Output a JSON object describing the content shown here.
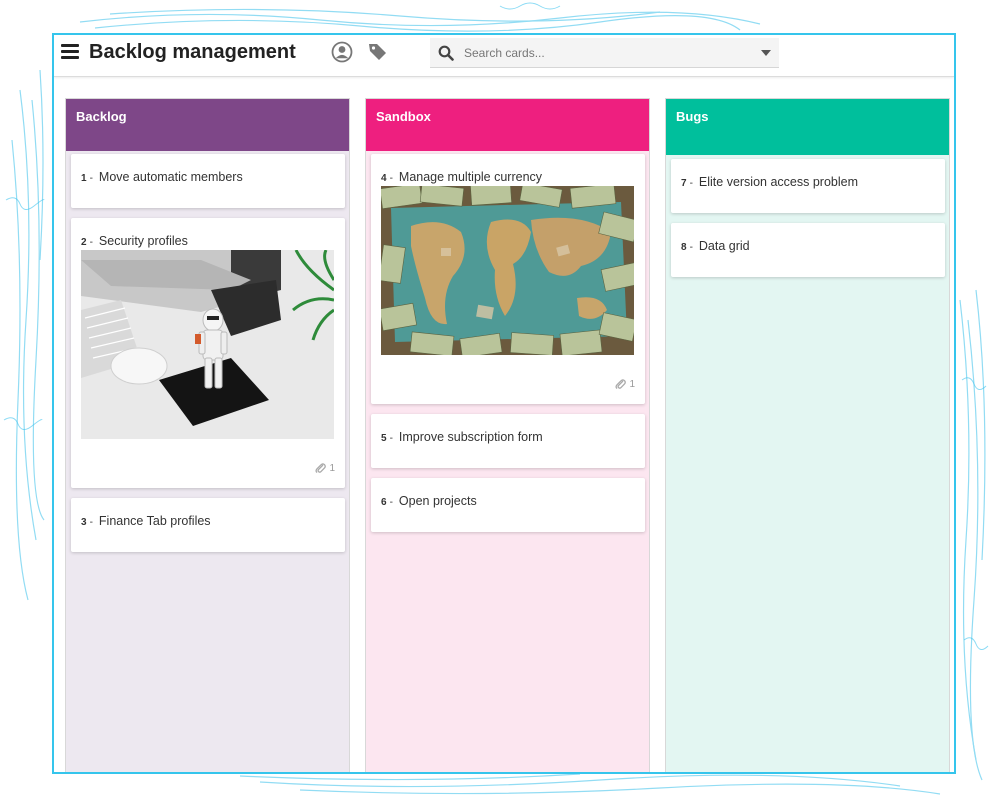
{
  "app": {
    "title": "Backlog management"
  },
  "search": {
    "placeholder": "Search cards..."
  },
  "icons": {
    "menu": "hamburger-menu-icon",
    "user": "user-circle-icon",
    "tag": "tag-icon",
    "search": "search-icon",
    "dropdown": "caret-down-icon",
    "attachment": "paperclip-icon"
  },
  "colors": {
    "frame_border": "#35c5ec",
    "backlog_header": "#7e4788",
    "backlog_body": "#ede8f0",
    "sandbox_header": "#ee1f7f",
    "sandbox_body": "#fce6f0",
    "bugs_header": "#00bf9c",
    "bugs_body": "#e3f6f2"
  },
  "columns": [
    {
      "name": "Backlog",
      "cards": [
        {
          "num": "1",
          "title": "Move automatic members"
        },
        {
          "num": "2",
          "title": "Security profiles",
          "image": "stormtrooper-figure-desk-photo",
          "attachments": "1"
        },
        {
          "num": "3",
          "title": "Finance Tab profiles"
        }
      ]
    },
    {
      "name": "Sandbox",
      "cards": [
        {
          "num": "4",
          "title": "Manage multiple currency",
          "image": "world-map-banknotes-photo",
          "attachments": "1"
        },
        {
          "num": "5",
          "title": "Improve subscription form"
        },
        {
          "num": "6",
          "title": "Open projects"
        }
      ]
    },
    {
      "name": "Bugs",
      "cards": [
        {
          "num": "7",
          "title": "Elite version access problem"
        },
        {
          "num": "8",
          "title": "Data grid"
        }
      ]
    }
  ]
}
